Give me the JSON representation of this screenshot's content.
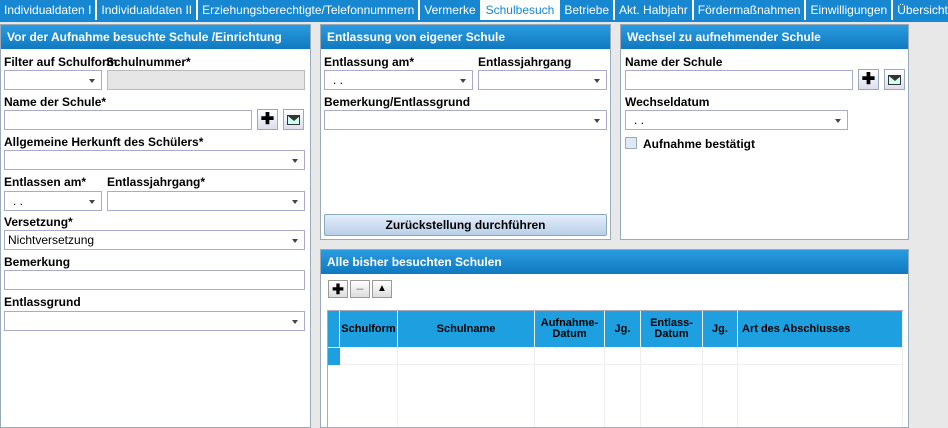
{
  "tabs": [
    {
      "label": "Individualdaten I",
      "active": false
    },
    {
      "label": "Individualdaten II",
      "active": false
    },
    {
      "label": "Erziehungsberechtigte/Telefonnummern",
      "active": false
    },
    {
      "label": "Vermerke",
      "active": false
    },
    {
      "label": "Schulbesuch",
      "active": true
    },
    {
      "label": "Betriebe",
      "active": false
    },
    {
      "label": "Akt. Halbjahr",
      "active": false
    },
    {
      "label": "Fördermaßnahmen",
      "active": false
    },
    {
      "label": "Einwilligungen",
      "active": false
    },
    {
      "label": "Übersicht",
      "active": false
    }
  ],
  "left_panel": {
    "title": "Vor der Aufnahme besuchte Schule /Einrichtung",
    "filter_label": "Filter auf Schulform",
    "filter_value": "",
    "schulnummer_label": "Schulnummer*",
    "schulnummer_value": "",
    "name_label": "Name der Schule*",
    "name_value": "",
    "herkunft_label": "Allgemeine Herkunft des Schülers*",
    "herkunft_value": "",
    "entlassen_label": "Entlassen am*",
    "entlassen_value": ". .",
    "entlassjahrgang_label": "Entlassjahrgang*",
    "entlassjahrgang_value": "",
    "versetzung_label": "Versetzung*",
    "versetzung_value": "Nichtversetzung",
    "bemerkung_label": "Bemerkung",
    "bemerkung_value": "",
    "entlassgrund_label": "Entlassgrund",
    "entlassgrund_value": ""
  },
  "middle_panel": {
    "title": "Entlassung von eigener Schule",
    "entlassung_label": "Entlassung am*",
    "entlassung_value": ". .",
    "jahrgang_label": "Entlassjahrgang",
    "jahrgang_value": "",
    "bemerkung_label": "Bemerkung/Entlassgrund",
    "bemerkung_value": "",
    "button_label": "Zurückstellung durchführen"
  },
  "right_panel": {
    "title": "Wechsel zu aufnehmender Schule",
    "name_label": "Name der Schule",
    "name_value": "",
    "datum_label": "Wechseldatum",
    "datum_value": ". .",
    "checkbox_label": "Aufnahme bestätigt"
  },
  "history_panel": {
    "title": "Alle bisher besuchten Schulen",
    "columns": [
      "Schulform",
      "Schulname",
      "Aufnahme-\nDatum",
      "Jg.",
      "Entlass-\nDatum",
      "Jg.",
      "Art des Abschlusses"
    ]
  },
  "icons": {
    "add": "plus-icon",
    "remove": "minus-icon",
    "up": "arrow-up-icon",
    "browse": "ellipsis-icon",
    "mail": "envelope-icon"
  },
  "colors": {
    "tab_bar": "#1687d0",
    "header": "#1079c0",
    "grid_header": "#1ea0e0"
  }
}
